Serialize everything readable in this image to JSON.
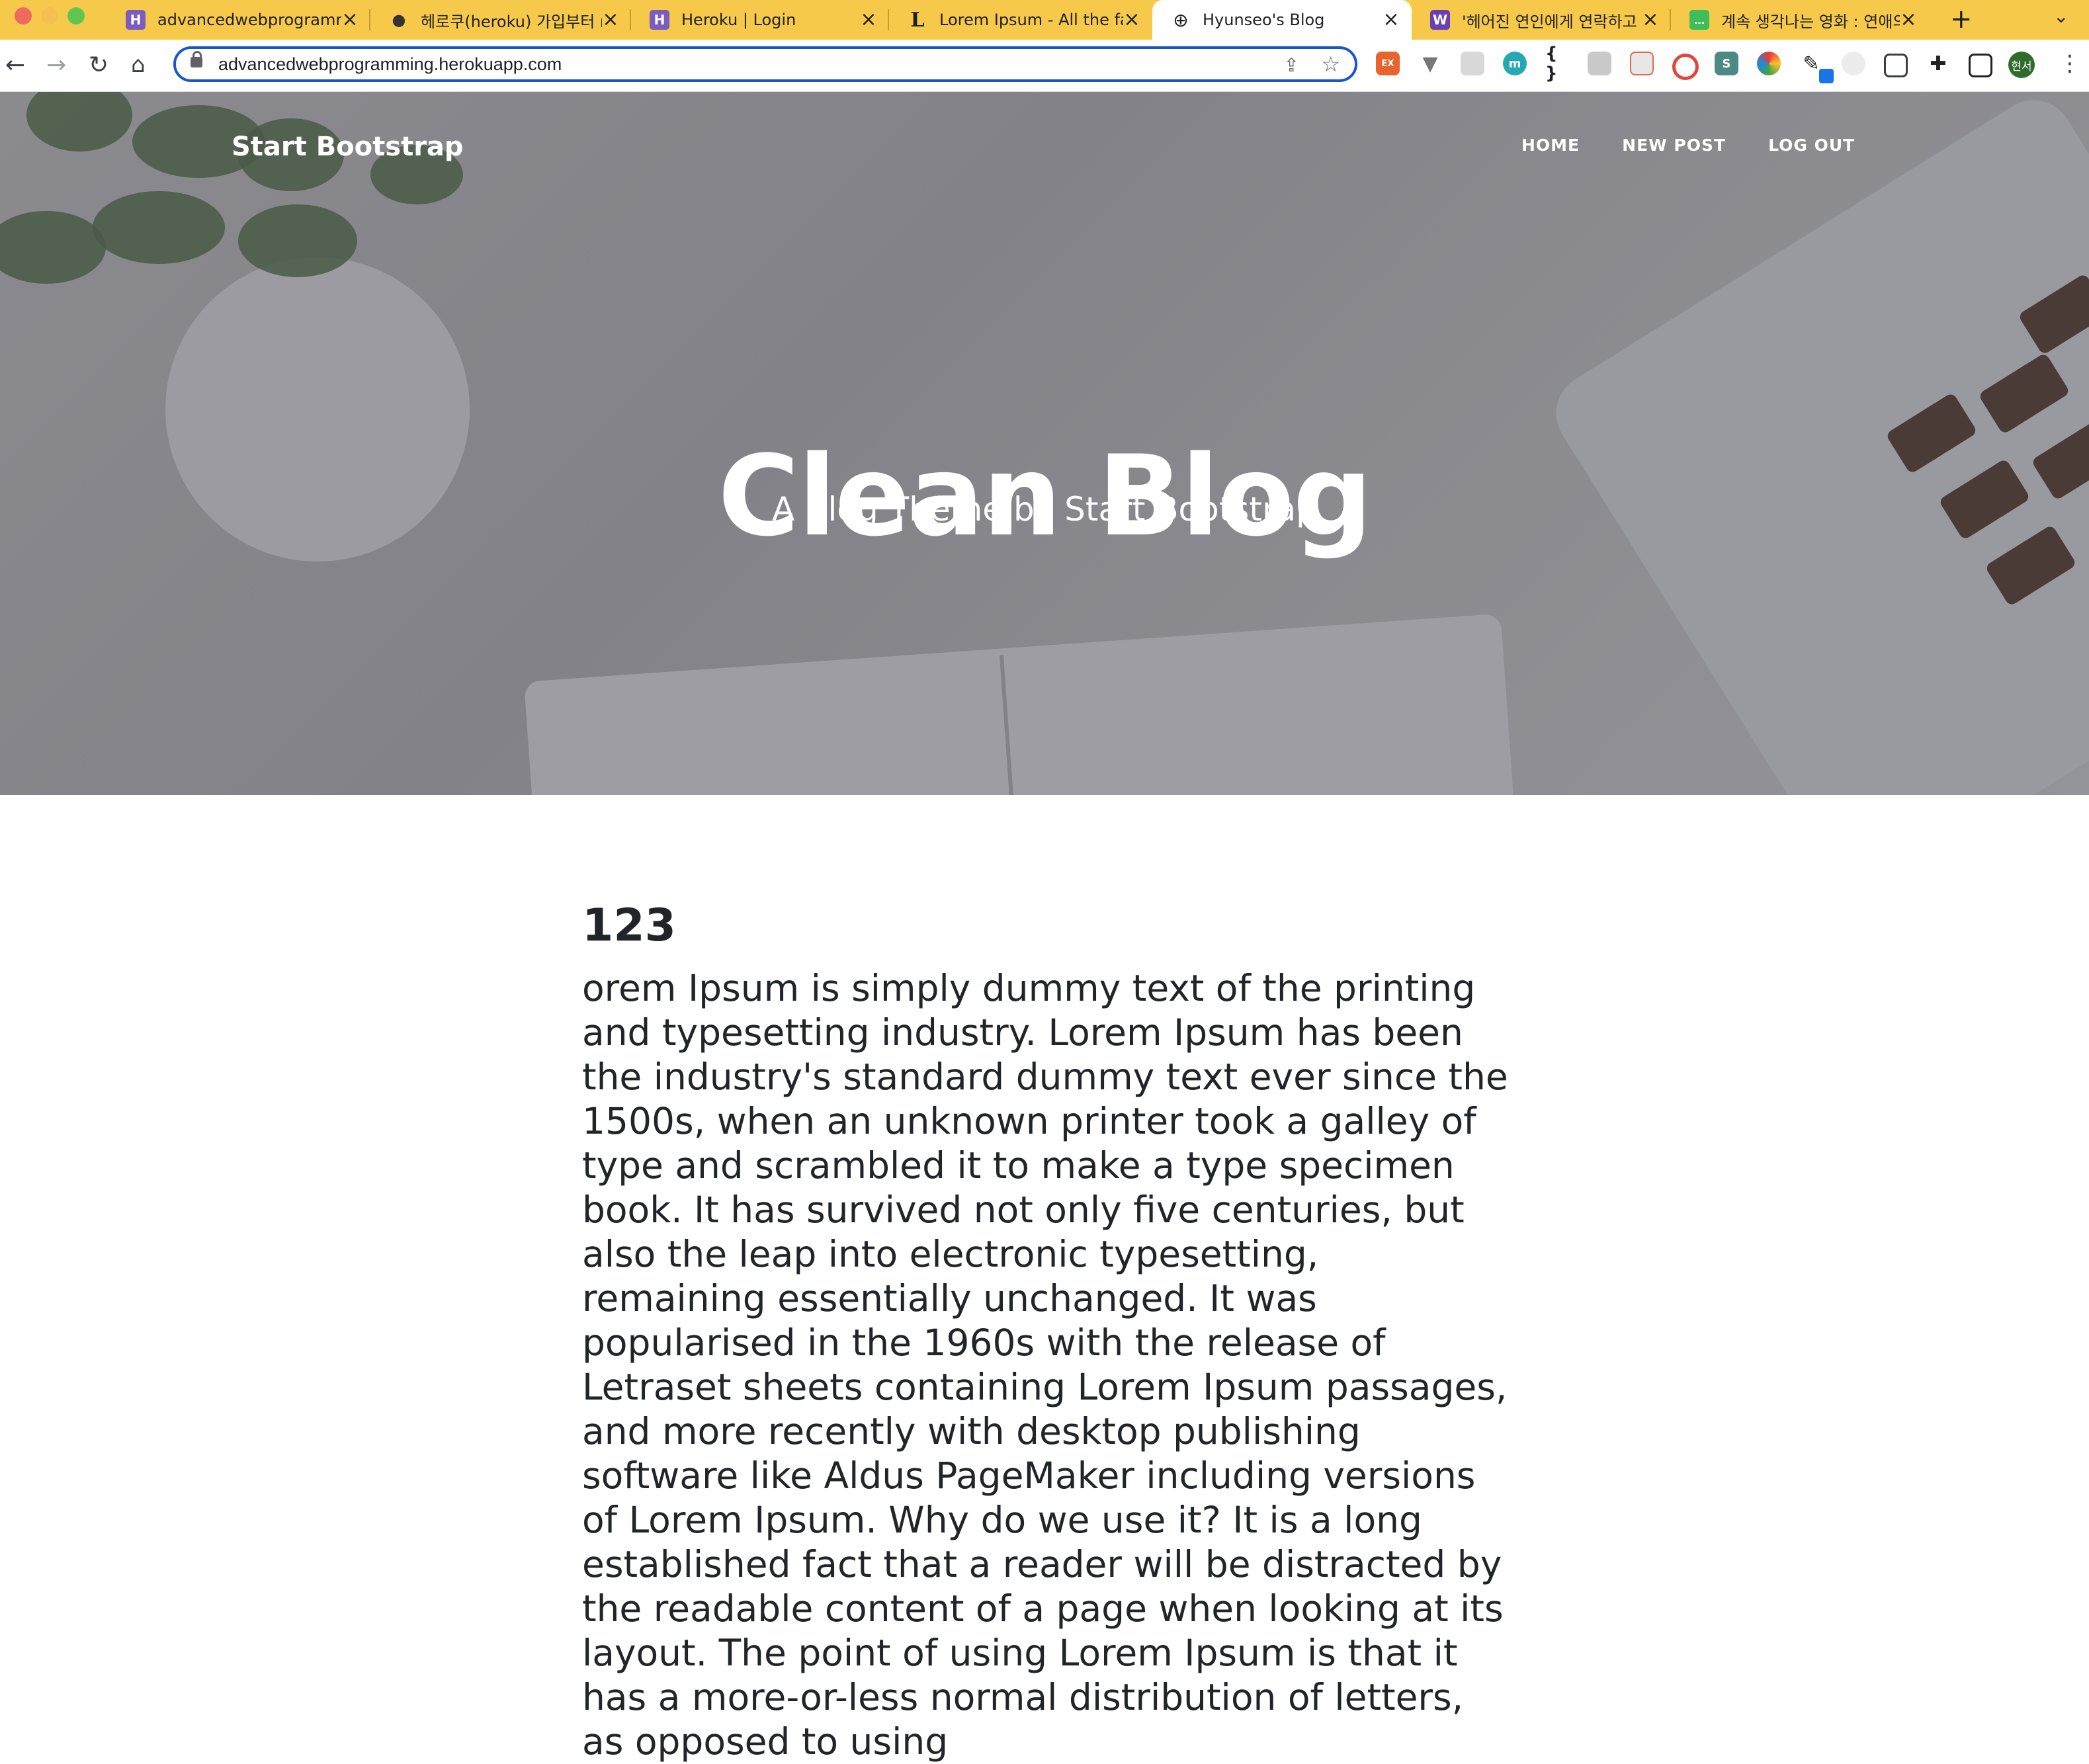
{
  "browser": {
    "tabs": [
      {
        "title": "advancedwebprogramming",
        "fav_color": "#7b5cbf",
        "fav_glyph": "H"
      },
      {
        "title": "헤로쿠(heroku) 가입부터 n",
        "fav_color": "#4a4a4a",
        "fav_glyph": "●"
      },
      {
        "title": "Heroku | Login",
        "fav_color": "#7b5cbf",
        "fav_glyph": "H"
      },
      {
        "title": "Lorem Ipsum - All the fa",
        "fav_color": "#f6c94a",
        "fav_glyph": "L"
      },
      {
        "title": "Hyunseo's Blog",
        "fav_color": "#ffffff",
        "fav_glyph": "🌐"
      },
      {
        "title": "'헤어진 연인에게 연락하고 ",
        "fav_color": "#6a3fb5",
        "fav_glyph": "W"
      },
      {
        "title": "계속 생각나는 영화 : 연애의",
        "fav_color": "#3dbe5a",
        "fav_glyph": "…"
      }
    ],
    "url": "advancedwebprogramming.herokuapp.com",
    "avatar_label": "현서"
  },
  "site": {
    "brand": "Start Bootstrap",
    "nav": [
      "HOME",
      "NEW POST",
      "LOG OUT"
    ],
    "hero_title": "Clean Blog",
    "hero_subtitle": "A Blog Theme by Start Bootstrap"
  },
  "post": {
    "title": "123",
    "body": "orem Ipsum is simply dummy text of the printing and typesetting industry. Lorem Ipsum has been the industry's standard dummy text ever since the 1500s, when an unknown printer took a galley of type and scrambled it to make a type specimen book. It has survived not only five centuries, but also the leap into electronic typesetting, remaining essentially unchanged. It was popularised in the 1960s with the release of Letraset sheets containing Lorem Ipsum passages, and more recently with desktop publishing software like Aldus PageMaker including versions of Lorem Ipsum. Why do we use it? It is a long established fact that a reader will be distracted by the readable content of a page when looking at its layout. The point of using Lorem Ipsum is that it has a more-or-less normal distribution of letters, as opposed to using"
  }
}
